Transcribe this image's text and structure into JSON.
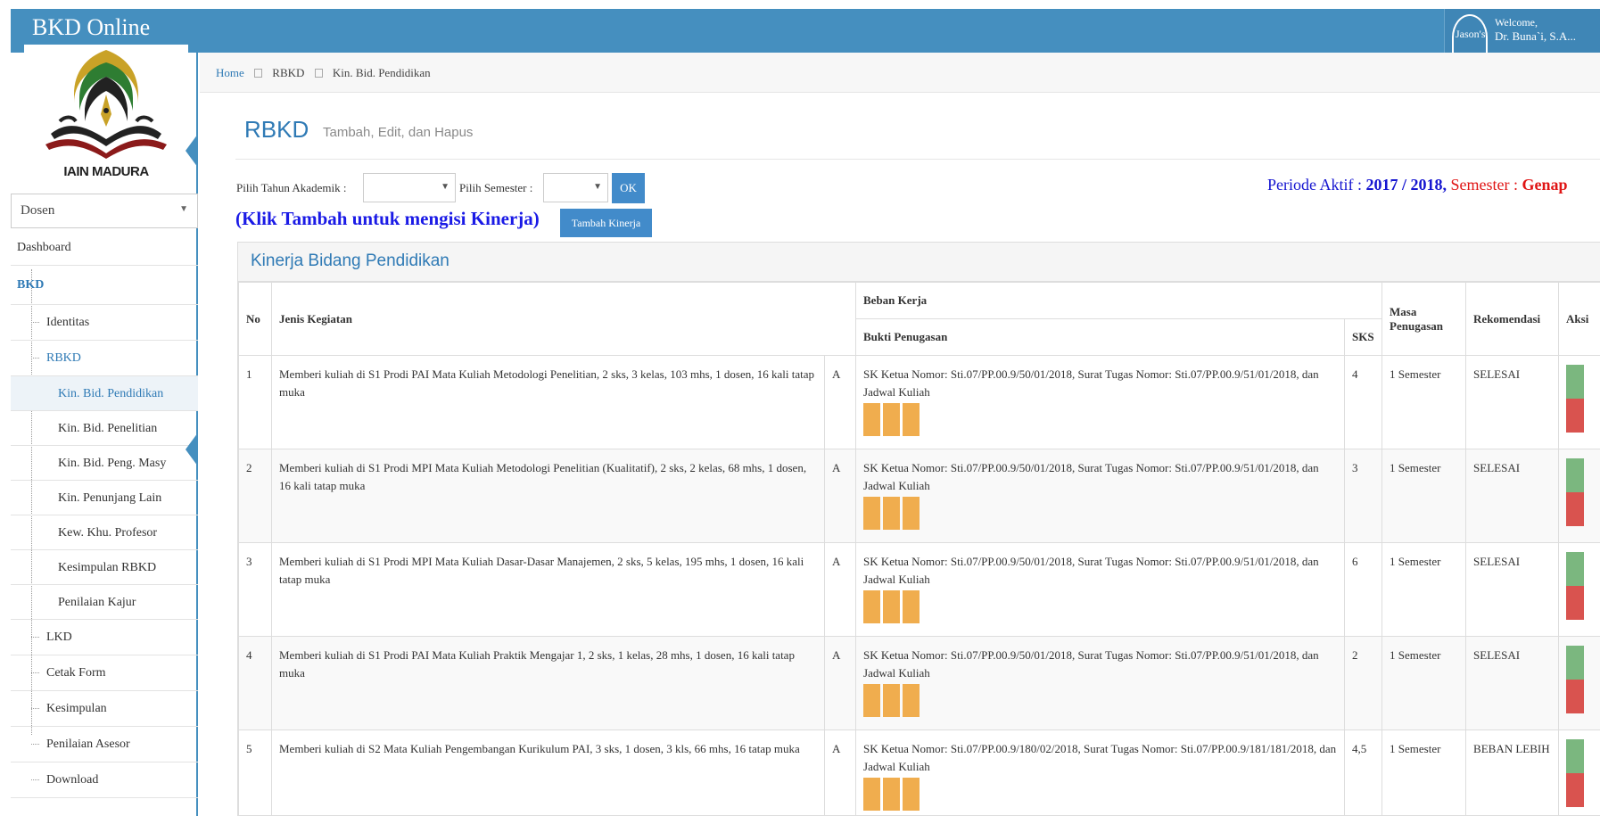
{
  "app": {
    "title": "BKD Online"
  },
  "user": {
    "avatar_text": "Jason's",
    "welcome": "Welcome,",
    "name": "Dr. Buna`i, S.A..."
  },
  "logo": {
    "text": "IAIN MADURA"
  },
  "sidebar": {
    "role": "Dosen",
    "items": {
      "dashboard": "Dashboard",
      "bkd": "BKD",
      "identitas": "Identitas",
      "rbkd": "RBKD",
      "kin_pendidikan": "Kin. Bid. Pendidikan",
      "kin_penelitian": "Kin. Bid. Penelitian",
      "kin_peng_masy": "Kin. Bid. Peng. Masy",
      "kin_penunjang": "Kin. Penunjang Lain",
      "kew_profesor": "Kew. Khu. Profesor",
      "kesimpulan_rbkd": "Kesimpulan RBKD",
      "penilaian_kajur": "Penilaian Kajur",
      "lkd": "LKD",
      "cetak_form": "Cetak Form",
      "kesimpulan": "Kesimpulan",
      "penilaian_asesor": "Penilaian Asesor",
      "download": "Download"
    }
  },
  "breadcrumb": [
    "Home",
    "RBKD",
    "Kin. Bid. Pendidikan"
  ],
  "page": {
    "title": "RBKD",
    "subtitle": "Tambah, Edit, dan Hapus"
  },
  "filters": {
    "tahun_label": "Pilih Tahun Akademik :",
    "semester_label": "Pilih Semester :",
    "ok_label": "OK"
  },
  "periode": {
    "label": "Periode Aktif :",
    "value": "2017 / 2018,",
    "semester_label": "Semester :",
    "semester_value": "Genap"
  },
  "klik_text": "(Klik Tambah untuk mengisi Kinerja)",
  "tambah_label": "Tambah Kinerja",
  "panel": {
    "title": "Kinerja Bidang Pendidikan"
  },
  "table": {
    "headers": {
      "no": "No",
      "jenis": "Jenis Kegiatan",
      "beban": "Beban Kerja",
      "bukti": "Bukti Penugasan",
      "sks": "SKS",
      "masa": "Masa Penugasan",
      "rekomendasi": "Rekomendasi",
      "aksi": "Aksi"
    },
    "rows": [
      {
        "no": "1",
        "jenis": "Memberi kuliah di S1 Prodi PAI Mata Kuliah Metodologi Penelitian, 2 sks, 3 kelas, 103 mhs, 1 dosen, 16 kali tatap muka",
        "kode": "A",
        "bukti": "SK Ketua Nomor: Sti.07/PP.00.9/50/01/2018, Surat Tugas Nomor: Sti.07/PP.00.9/51/01/2018, dan Jadwal Kuliah",
        "sks": "4",
        "masa": "1 Semester",
        "rekomendasi": "SELESAI"
      },
      {
        "no": "2",
        "jenis": "Memberi kuliah di S1 Prodi MPI Mata Kuliah Metodologi Penelitian (Kualitatif), 2 sks, 2 kelas, 68 mhs, 1 dosen, 16 kali tatap muka",
        "kode": "A",
        "bukti": "SK Ketua Nomor: Sti.07/PP.00.9/50/01/2018, Surat Tugas Nomor: Sti.07/PP.00.9/51/01/2018, dan Jadwal Kuliah",
        "sks": "3",
        "masa": "1 Semester",
        "rekomendasi": "SELESAI"
      },
      {
        "no": "3",
        "jenis": "Memberi kuliah di S1 Prodi MPI Mata Kuliah Dasar-Dasar Manajemen, 2 sks, 5 kelas, 195 mhs, 1 dosen, 16 kali tatap muka",
        "kode": "A",
        "bukti": "SK Ketua Nomor: Sti.07/PP.00.9/50/01/2018, Surat Tugas Nomor: Sti.07/PP.00.9/51/01/2018, dan Jadwal Kuliah",
        "sks": "6",
        "masa": "1 Semester",
        "rekomendasi": "SELESAI"
      },
      {
        "no": "4",
        "jenis": "Memberi kuliah di S1 Prodi PAI Mata Kuliah Praktik Mengajar 1, 2 sks, 1 kelas, 28 mhs, 1 dosen, 16 kali tatap muka",
        "kode": "A",
        "bukti": "SK Ketua Nomor: Sti.07/PP.00.9/50/01/2018, Surat Tugas Nomor: Sti.07/PP.00.9/51/01/2018, dan Jadwal Kuliah",
        "sks": "2",
        "masa": "1 Semester",
        "rekomendasi": "SELESAI"
      },
      {
        "no": "5",
        "jenis": "Memberi kuliah di S2 Mata Kuliah Pengembangan Kurikulum PAI, 3 sks, 1 dosen, 3 kls, 66 mhs, 16 tatap muka",
        "kode": "A",
        "bukti": "SK Ketua Nomor: Sti.07/PP.00.9/180/02/2018, Surat Tugas Nomor: Sti.07/PP.00.9/181/181/2018, dan Jadwal Kuliah",
        "sks": "4,5",
        "masa": "1 Semester",
        "rekomendasi": "BEBAN LEBIH"
      }
    ]
  },
  "colors": {
    "header_blue": "#458fbf",
    "link_blue": "#2f7ab5",
    "button_blue": "#428bca",
    "file_orange": "#f0ad4e",
    "edit_green": "#7bb77f",
    "delete_red": "#d9534f",
    "periode_blue": "#1515d0",
    "periode_red": "#e01515"
  }
}
